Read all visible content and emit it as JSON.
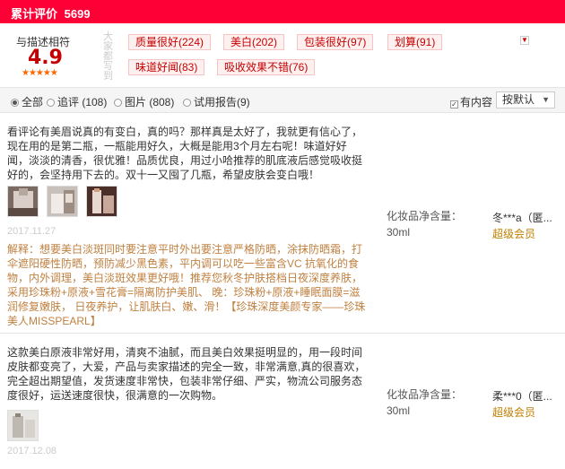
{
  "header": {
    "title": "累计评价",
    "count": "5699"
  },
  "rating": {
    "label": "与描述相符",
    "score": "4.9",
    "stars": "★★★★★",
    "vertical_label": "大家都写到",
    "tags": [
      {
        "text": "质量很好(224)"
      },
      {
        "text": "美白(202)"
      },
      {
        "text": "包装很好(97)"
      },
      {
        "text": "划算(91)"
      },
      {
        "text": "味道好闻(83)"
      },
      {
        "text": "吸收效果不错(76)"
      }
    ]
  },
  "filters": {
    "all": "全部",
    "followup": "追评 (108)",
    "pictures": "图片 (808)",
    "trial": "试用报告(9)",
    "has_content": "有内容",
    "sort": "按默认"
  },
  "reviews": [
    {
      "text": "看评论有美眉说真的有变白，真的吗？那样真是太好了，我就更有信心了，现在用的是第二瓶，一瓶能用好久，大概是能用3个月左右呢！味道好好闻，淡淡的清香，很优雅！品质优良，用过小哈推荐的肌底液后感觉吸收挺好的，会坚持用下去的。双十一又囤了几瓶，希望皮肤会变白哦！",
      "date": "2017.11.27",
      "sku": "化妆品净含量：30ml",
      "user": "冬***a（匿...",
      "vip": "超级会员",
      "reply": "解释：想要美白淡斑同时要注意平时外出要注意严格防晒，涂抹防晒霜，打伞遮阳硬性防晒，预防减少黑色素，平内调可以吃一些富含VC 抗氧化的食物，内外调理，美白淡斑效果更好哦！推荐您秋冬护肤搭档日夜深度养肤，采用珍珠粉+原液+雪花膏=隔离防护美肌、 晚：珍珠粉+原液+睡眠面膜=滋润修复嫩肤， 日夜养护，让肌肤白、嫩、滑！【珍珠深度美颜专家——珍珠美人MISSPEARL】"
    },
    {
      "text": "这款美白原液非常好用，清爽不油腻，而且美白效果挺明显的，用一段时间皮肤都变亮了，大爱，产品与卖家描述的完全一致，非常满意,真的很喜欢，完全超出期望值，发货速度非常快，包装非常仔细、严实，物流公司服务态度很好，运送速度很快，很满意的一次购物。",
      "date": "2017.12.08",
      "sku": "化妆品净含量：30ml",
      "user": "柔***0（匿...",
      "vip": "超级会员"
    }
  ]
}
